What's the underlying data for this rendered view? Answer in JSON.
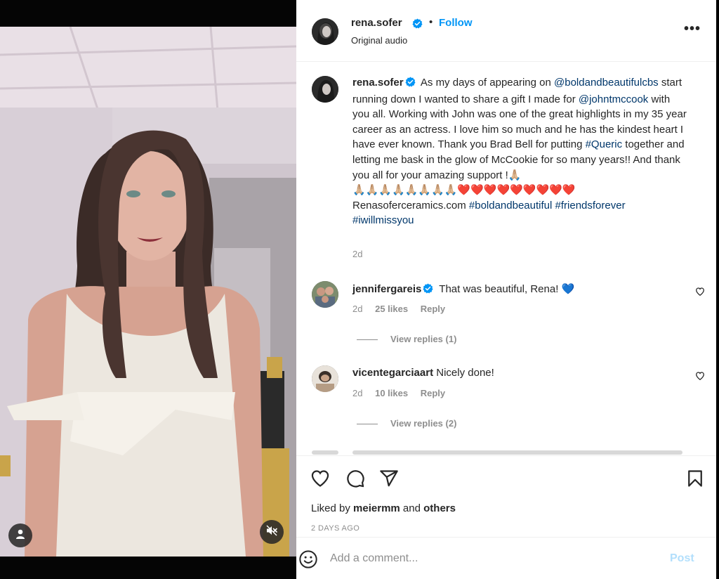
{
  "header": {
    "username": "rena.sofer",
    "separator": "•",
    "follow_label": "Follow",
    "audio_label": "Original audio",
    "more_label": "•••"
  },
  "caption": {
    "username": "rena.sofer",
    "text_1": "As my days of appearing on",
    "mention_1": "@boldandbeautifulcbs",
    "text_2": "start running down I wanted to share a gift I made for",
    "mention_2": "@johntmccook",
    "text_3": "with you all. Working with John was one of the great highlights in my 35 year career as an actress. I love him so much and he has the kindest heart I have ever known. Thank you Brad Bell for putting",
    "hashtag_1": "#Queric",
    "text_4": "together and letting me bask in the glow of McCookie for so many years!! And thank you all for your amazing support !🙏🏼",
    "emojis_pray": "🙏🏼🙏🏼🙏🏼🙏🏼🙏🏼🙏🏼🙏🏼🙏🏼",
    "emojis_heart": "❤️❤️❤️❤️❤️❤️❤️❤️❤️",
    "text_5": "Renasoferceramics.com",
    "hashtag_2": "#boldandbeautiful",
    "hashtag_3": "#friendsforever",
    "hashtag_4": "#iwillmissyou",
    "time": "2d"
  },
  "comments": [
    {
      "username": "jennifergareis",
      "verified": true,
      "text": "That was beautiful, Rena! 💙",
      "time": "2d",
      "likes": "25 likes",
      "reply_label": "Reply",
      "view_replies": "View replies (1)"
    },
    {
      "username": "vicentegarciaart",
      "verified": false,
      "text": "Nicely done!",
      "time": "2d",
      "likes": "10 likes",
      "reply_label": "Reply",
      "view_replies": "View replies (2)"
    }
  ],
  "actions": {
    "liked_by_prefix": "Liked by",
    "liked_by_user": "meiermm",
    "liked_by_and": "and",
    "liked_by_others": "others",
    "date": "2 DAYS AGO"
  },
  "comment_bar": {
    "placeholder": "Add a comment...",
    "post_label": "Post"
  },
  "icons": {
    "verified": "verified-badge-icon",
    "heart": "heart-icon",
    "comment": "comment-icon",
    "share": "share-icon",
    "save": "bookmark-icon",
    "emoji": "emoji-icon",
    "more": "more-options-icon",
    "user": "user-tag-icon",
    "mute": "muted-speaker-icon"
  },
  "colors": {
    "link": "#00376b",
    "follow": "#0095f6",
    "post_disabled": "#b2dffc",
    "verified": "#0095f6",
    "secondary_text": "#8e8e8e"
  }
}
